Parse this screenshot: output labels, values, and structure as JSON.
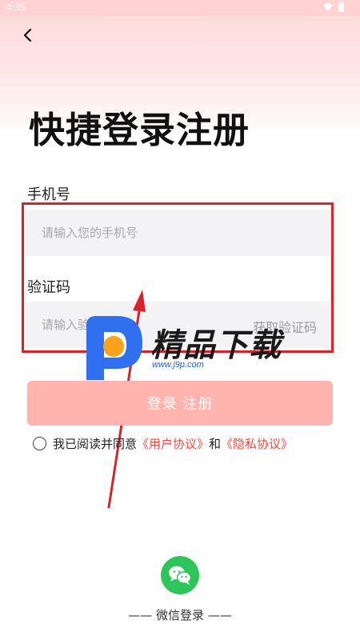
{
  "status_bar": {
    "time": "4:35"
  },
  "page": {
    "title": "快捷登录注册"
  },
  "form": {
    "phone_label": "手机号",
    "phone_placeholder": "请输入您的手机号",
    "code_label": "验证码",
    "code_placeholder": "请输入验证码",
    "get_code_label": "获取验证码"
  },
  "login_button": {
    "label": "登录 注册"
  },
  "agreement": {
    "prefix": "我已阅读并同意",
    "user_agreement": "《用户协议》",
    "and": "和",
    "privacy_policy": "《隐私协议》"
  },
  "wechat": {
    "caption": "—— 微信登录 ——"
  },
  "watermark": {
    "brand": "精品下载",
    "url": "www.j9p.com"
  },
  "colors": {
    "accent": "#f04a43",
    "login_button_bg": "#ffb4b0",
    "wechat_green": "#2ec55a",
    "highlight_red": "#d9232b"
  }
}
